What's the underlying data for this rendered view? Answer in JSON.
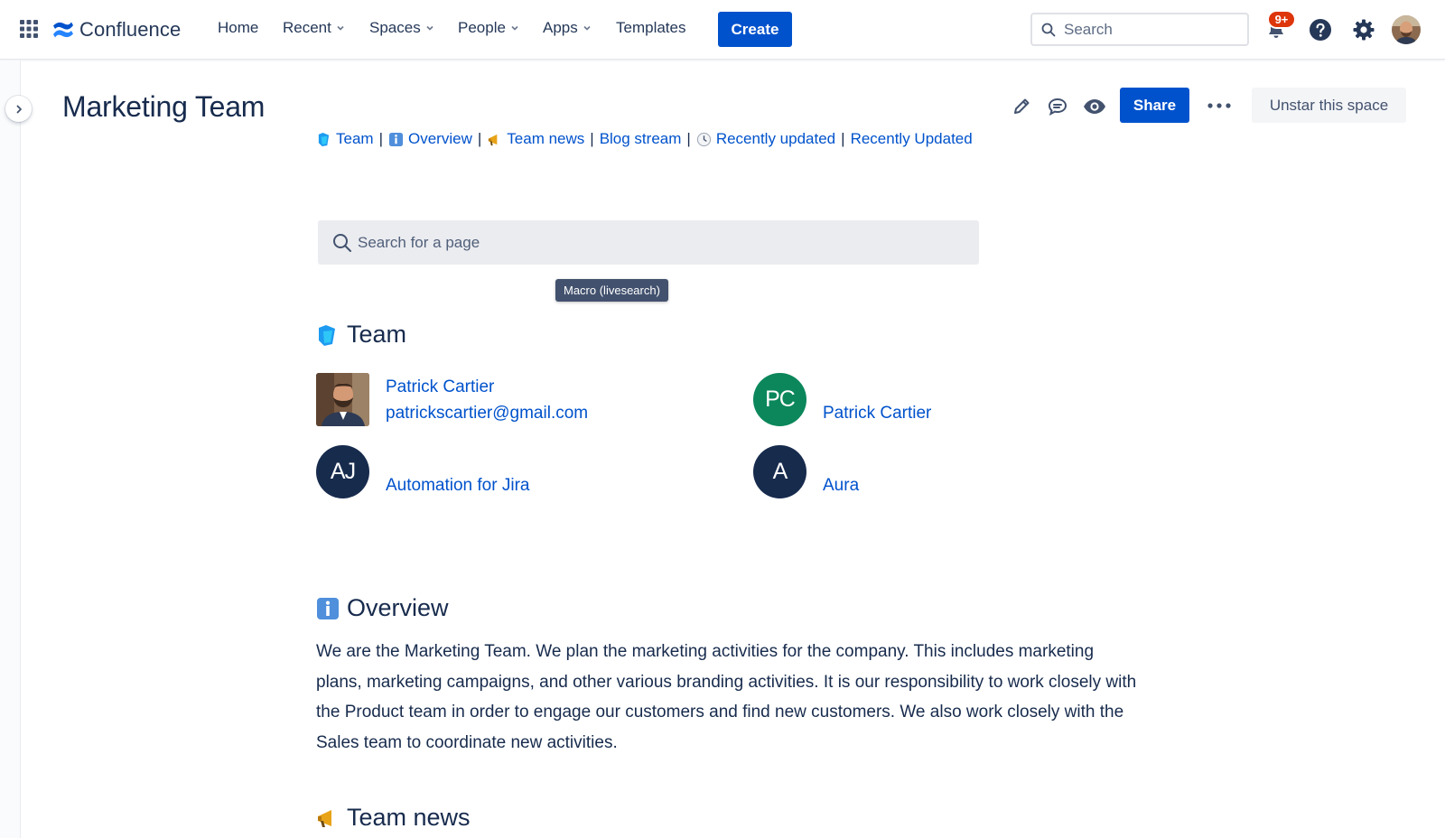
{
  "app": {
    "name": "Confluence"
  },
  "nav": {
    "items": [
      {
        "label": "Home",
        "dropdown": false
      },
      {
        "label": "Recent",
        "dropdown": true
      },
      {
        "label": "Spaces",
        "dropdown": true
      },
      {
        "label": "People",
        "dropdown": true
      },
      {
        "label": "Apps",
        "dropdown": true
      },
      {
        "label": "Templates",
        "dropdown": false
      }
    ],
    "create_label": "Create",
    "search_placeholder": "Search",
    "notification_count": "9+"
  },
  "page": {
    "title": "Marketing Team",
    "share_label": "Share",
    "unstar_label": "Unstar this space"
  },
  "links_bar": [
    {
      "label": "Team",
      "icon": "team-emoji"
    },
    {
      "label": "Overview",
      "icon": "info-emoji"
    },
    {
      "label": "Team news",
      "icon": "megaphone-emoji"
    },
    {
      "label": "Blog stream",
      "icon": null
    },
    {
      "label": "Recently updated",
      "icon": "clock-emoji"
    },
    {
      "label": "Recently Updated",
      "icon": null
    }
  ],
  "page_search": {
    "placeholder": "Search for a page",
    "tooltip": "Macro (livesearch)"
  },
  "team_section": {
    "heading": "Team",
    "members": [
      {
        "name": "Patrick Cartier",
        "email": "patrickscartier@gmail.com",
        "avatar": "photo"
      },
      {
        "name": "Patrick Cartier",
        "initials": "PC",
        "avatar_color": "#0B875B"
      },
      {
        "name": "Automation for Jira",
        "initials": "AJ",
        "avatar_color": "#172B4D"
      },
      {
        "name": "Aura",
        "initials": "A",
        "avatar_color": "#172B4D"
      }
    ]
  },
  "overview_section": {
    "heading": "Overview",
    "body": "We are the Marketing Team. We plan the marketing activities for the company. This includes marketing plans, marketing campaigns, and other various branding activities. It is our responsibility to work closely with the Product team in order to engage our customers and find new customers. We also work closely with the Sales team to coordinate new activities."
  },
  "news_section": {
    "heading": "Team news"
  },
  "colors": {
    "brand_blue": "#0052CC",
    "text": "#172B4D",
    "link": "#0052CC",
    "badge_red": "#DE350B"
  }
}
